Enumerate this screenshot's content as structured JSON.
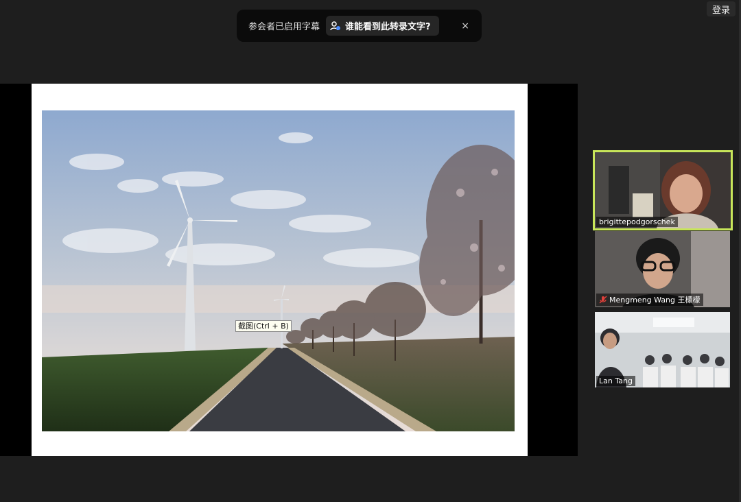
{
  "notification": {
    "text": "参会者已启用字幕",
    "button_label": "谁能看到此转录文字?",
    "close_label": "×"
  },
  "top_right": {
    "signin_label": "登录"
  },
  "tooltip": {
    "text": "截图(Ctrl + B)"
  },
  "participants": [
    {
      "name": "brigittepodgorschek",
      "active_speaker": true,
      "muted": false
    },
    {
      "name": "Mengmeng Wang 王檬檬",
      "active_speaker": false,
      "muted": true
    },
    {
      "name": "Lan Tang",
      "active_speaker": false,
      "muted": false
    }
  ],
  "colors": {
    "active_speaker_border": "#c8e65a",
    "muted_icon": "#e0403a"
  }
}
